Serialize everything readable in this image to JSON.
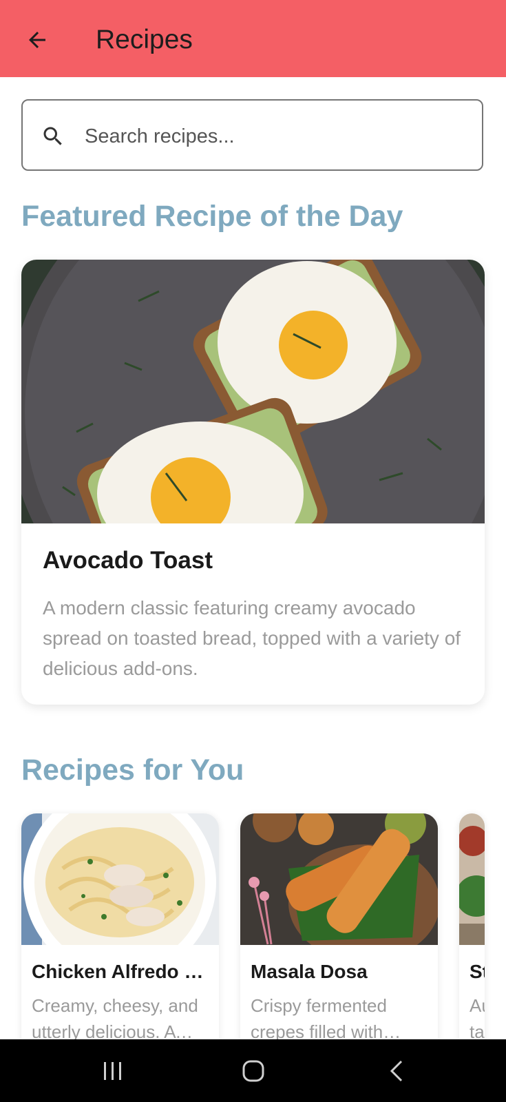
{
  "appbar": {
    "title": "Recipes",
    "back_icon": "arrow-left-icon",
    "color": "#f45f65"
  },
  "search": {
    "placeholder": "Search recipes...",
    "icon": "search-icon"
  },
  "featured": {
    "section_title": "Featured Recipe of the Day",
    "recipe": {
      "name": "Avocado Toast",
      "description": "A modern classic featuring creamy avocado spread on toasted bread, topped with a variety of delicious add-ons."
    }
  },
  "for_you": {
    "section_title": "Recipes for You",
    "recipes": [
      {
        "name": "Chicken Alfredo Pasta",
        "description": "Creamy, cheesy, and utterly delicious. A classic Italian favorite."
      },
      {
        "name": "Masala Dosa",
        "description": "Crispy fermented crepes filled with spiced potato filling."
      },
      {
        "name": "St",
        "description": "Au ta"
      }
    ]
  },
  "accent_color": "#7fa9bf",
  "system_nav": {
    "recents": "recents-icon",
    "home": "home-icon",
    "back": "back-icon"
  }
}
